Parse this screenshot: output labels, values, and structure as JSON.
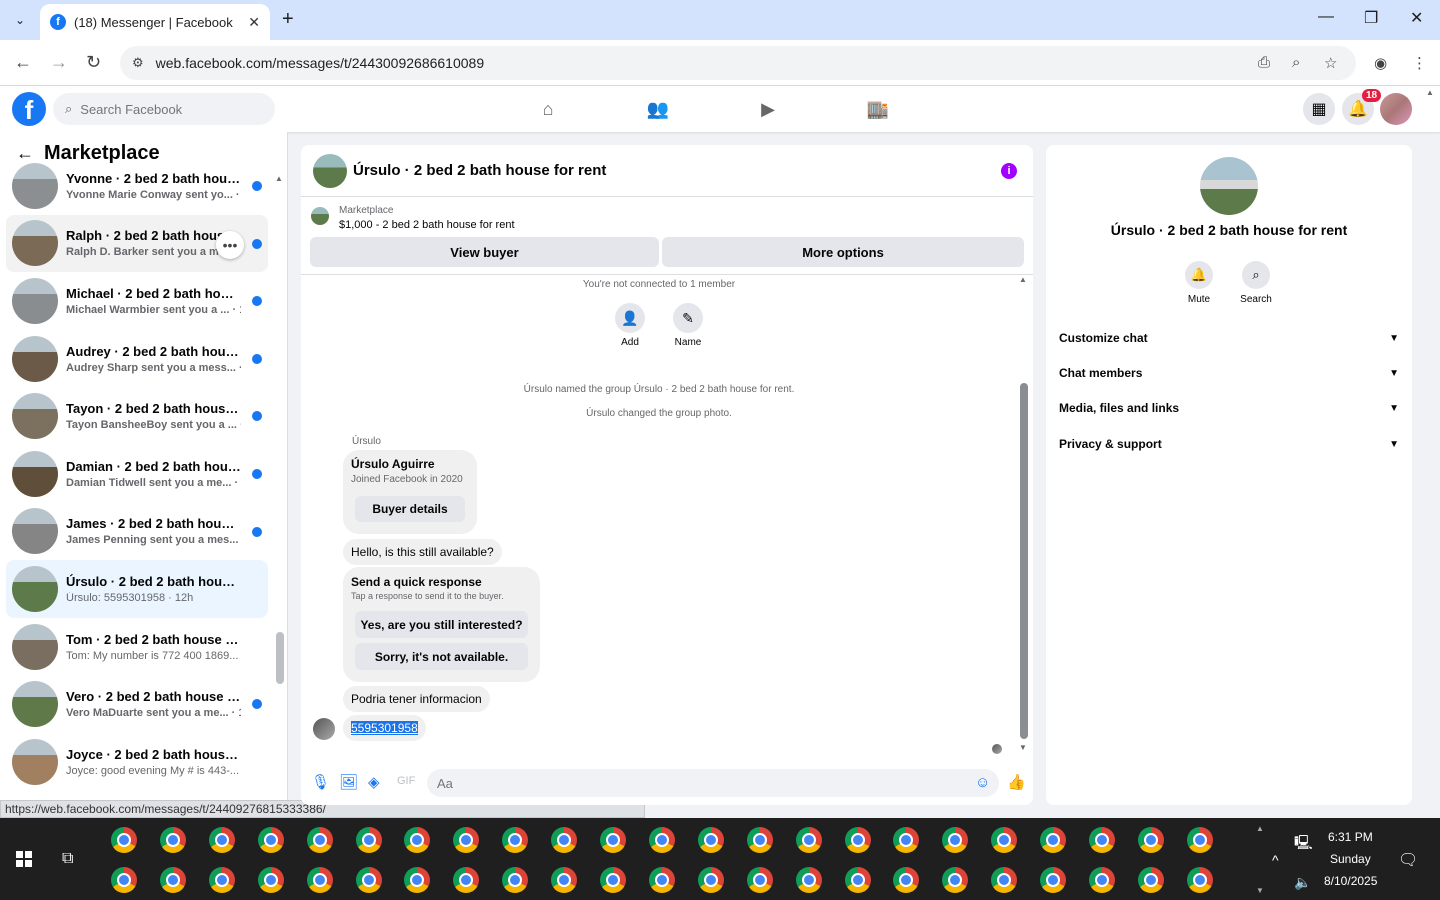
{
  "browser": {
    "tab_title": "(18) Messenger | Facebook",
    "url": "web.facebook.com/messages/t/24430092686610089",
    "status_url": "https://web.facebook.com/messages/t/24409276815333386/"
  },
  "fb": {
    "search_placeholder": "Search Facebook",
    "notification_count": "18"
  },
  "left": {
    "title": "Marketplace",
    "conversations": [
      {
        "name": "Yvonne · 2 bed 2 bath house f...",
        "sub": "Yvonne Marie Conway sent yo... · 11h",
        "unread": true,
        "color": "#8c8f91"
      },
      {
        "name": "Ralph · 2 bed 2 bath house f...",
        "sub": "Ralph D. Barker sent you a me...",
        "unread": true,
        "color": "#7b6a55"
      },
      {
        "name": "Michael · 2 bed 2 bath house ...",
        "sub": "Michael Warmbier sent you a ... · 11h",
        "unread": true,
        "color": "#8a8d90"
      },
      {
        "name": "Audrey · 2 bed 2 bath house f...",
        "sub": "Audrey Sharp sent you a mess... · 12h",
        "unread": true,
        "color": "#6b5a48"
      },
      {
        "name": "Tayon · 2 bed 2 bath house fo...",
        "sub": "Tayon BansheeBoy sent you a ... · 12h",
        "unread": true,
        "color": "#7c705e"
      },
      {
        "name": "Damian · 2 bed 2 bath house f...",
        "sub": "Damian Tidwell sent you a me... · 12h",
        "unread": true,
        "color": "#5e4e3a"
      },
      {
        "name": "James · 2 bed 2 bath house fo...",
        "sub": "James Penning sent you a mes... · 12h",
        "unread": true,
        "color": "#858585"
      },
      {
        "name": "Úrsulo · 2 bed 2 bath house for ...",
        "sub": "Úrsulo: 5595301958 · 12h",
        "unread": false,
        "color": "#5d7a4a"
      },
      {
        "name": "Tom · 2 bed 2 bath house for rent",
        "sub": "Tom: My number is 772 400 1869... · 12h",
        "unread": false,
        "color": "#7a6e60"
      },
      {
        "name": "Vero · 2 bed 2 bath house for ...",
        "sub": "Vero MaDuarte sent you a me... · 12h",
        "unread": true,
        "color": "#5f7a48"
      },
      {
        "name": "Joyce · 2 bed 2 bath house for r...",
        "sub": "Joyce: good evening My # is 443-... · 12h",
        "unread": false,
        "color": "#a08060"
      }
    ]
  },
  "chat": {
    "title": "Úrsulo · 2 bed 2 bath house for rent",
    "marketplace_label": "Marketplace",
    "listing": "$1,000 - 2 bed 2 bath house for rent",
    "view_buyer": "View buyer",
    "more_options": "More options",
    "not_connected": "You're not connected to 1 member",
    "add": "Add",
    "name": "Name",
    "event1": "Úrsulo named the group Úrsulo · 2 bed 2 bath house for rent.",
    "event2": "Úrsulo changed the group photo.",
    "sender": "Úrsulo",
    "buyer_name": "Úrsulo Aguirre",
    "joined": "Joined Facebook in 2020",
    "buyer_details": "Buyer details",
    "msg1": "Hello, is this still available?",
    "quick_title": "Send a quick response",
    "quick_sub": "Tap a response to send it to the buyer.",
    "quick1": "Yes, are you still interested?",
    "quick2": "Sorry, it's not available.",
    "msg2": "Podria tener informacion",
    "msg3": "5595301958",
    "composer_placeholder": "Aa"
  },
  "right": {
    "title": "Úrsulo · 2 bed 2 bath house for rent",
    "mute": "Mute",
    "search": "Search",
    "rows": [
      "Customize chat",
      "Chat members",
      "Media, files and links",
      "Privacy & support"
    ]
  },
  "taskbar": {
    "time": "6:31 PM",
    "day": "Sunday",
    "date": "8/10/2025"
  }
}
